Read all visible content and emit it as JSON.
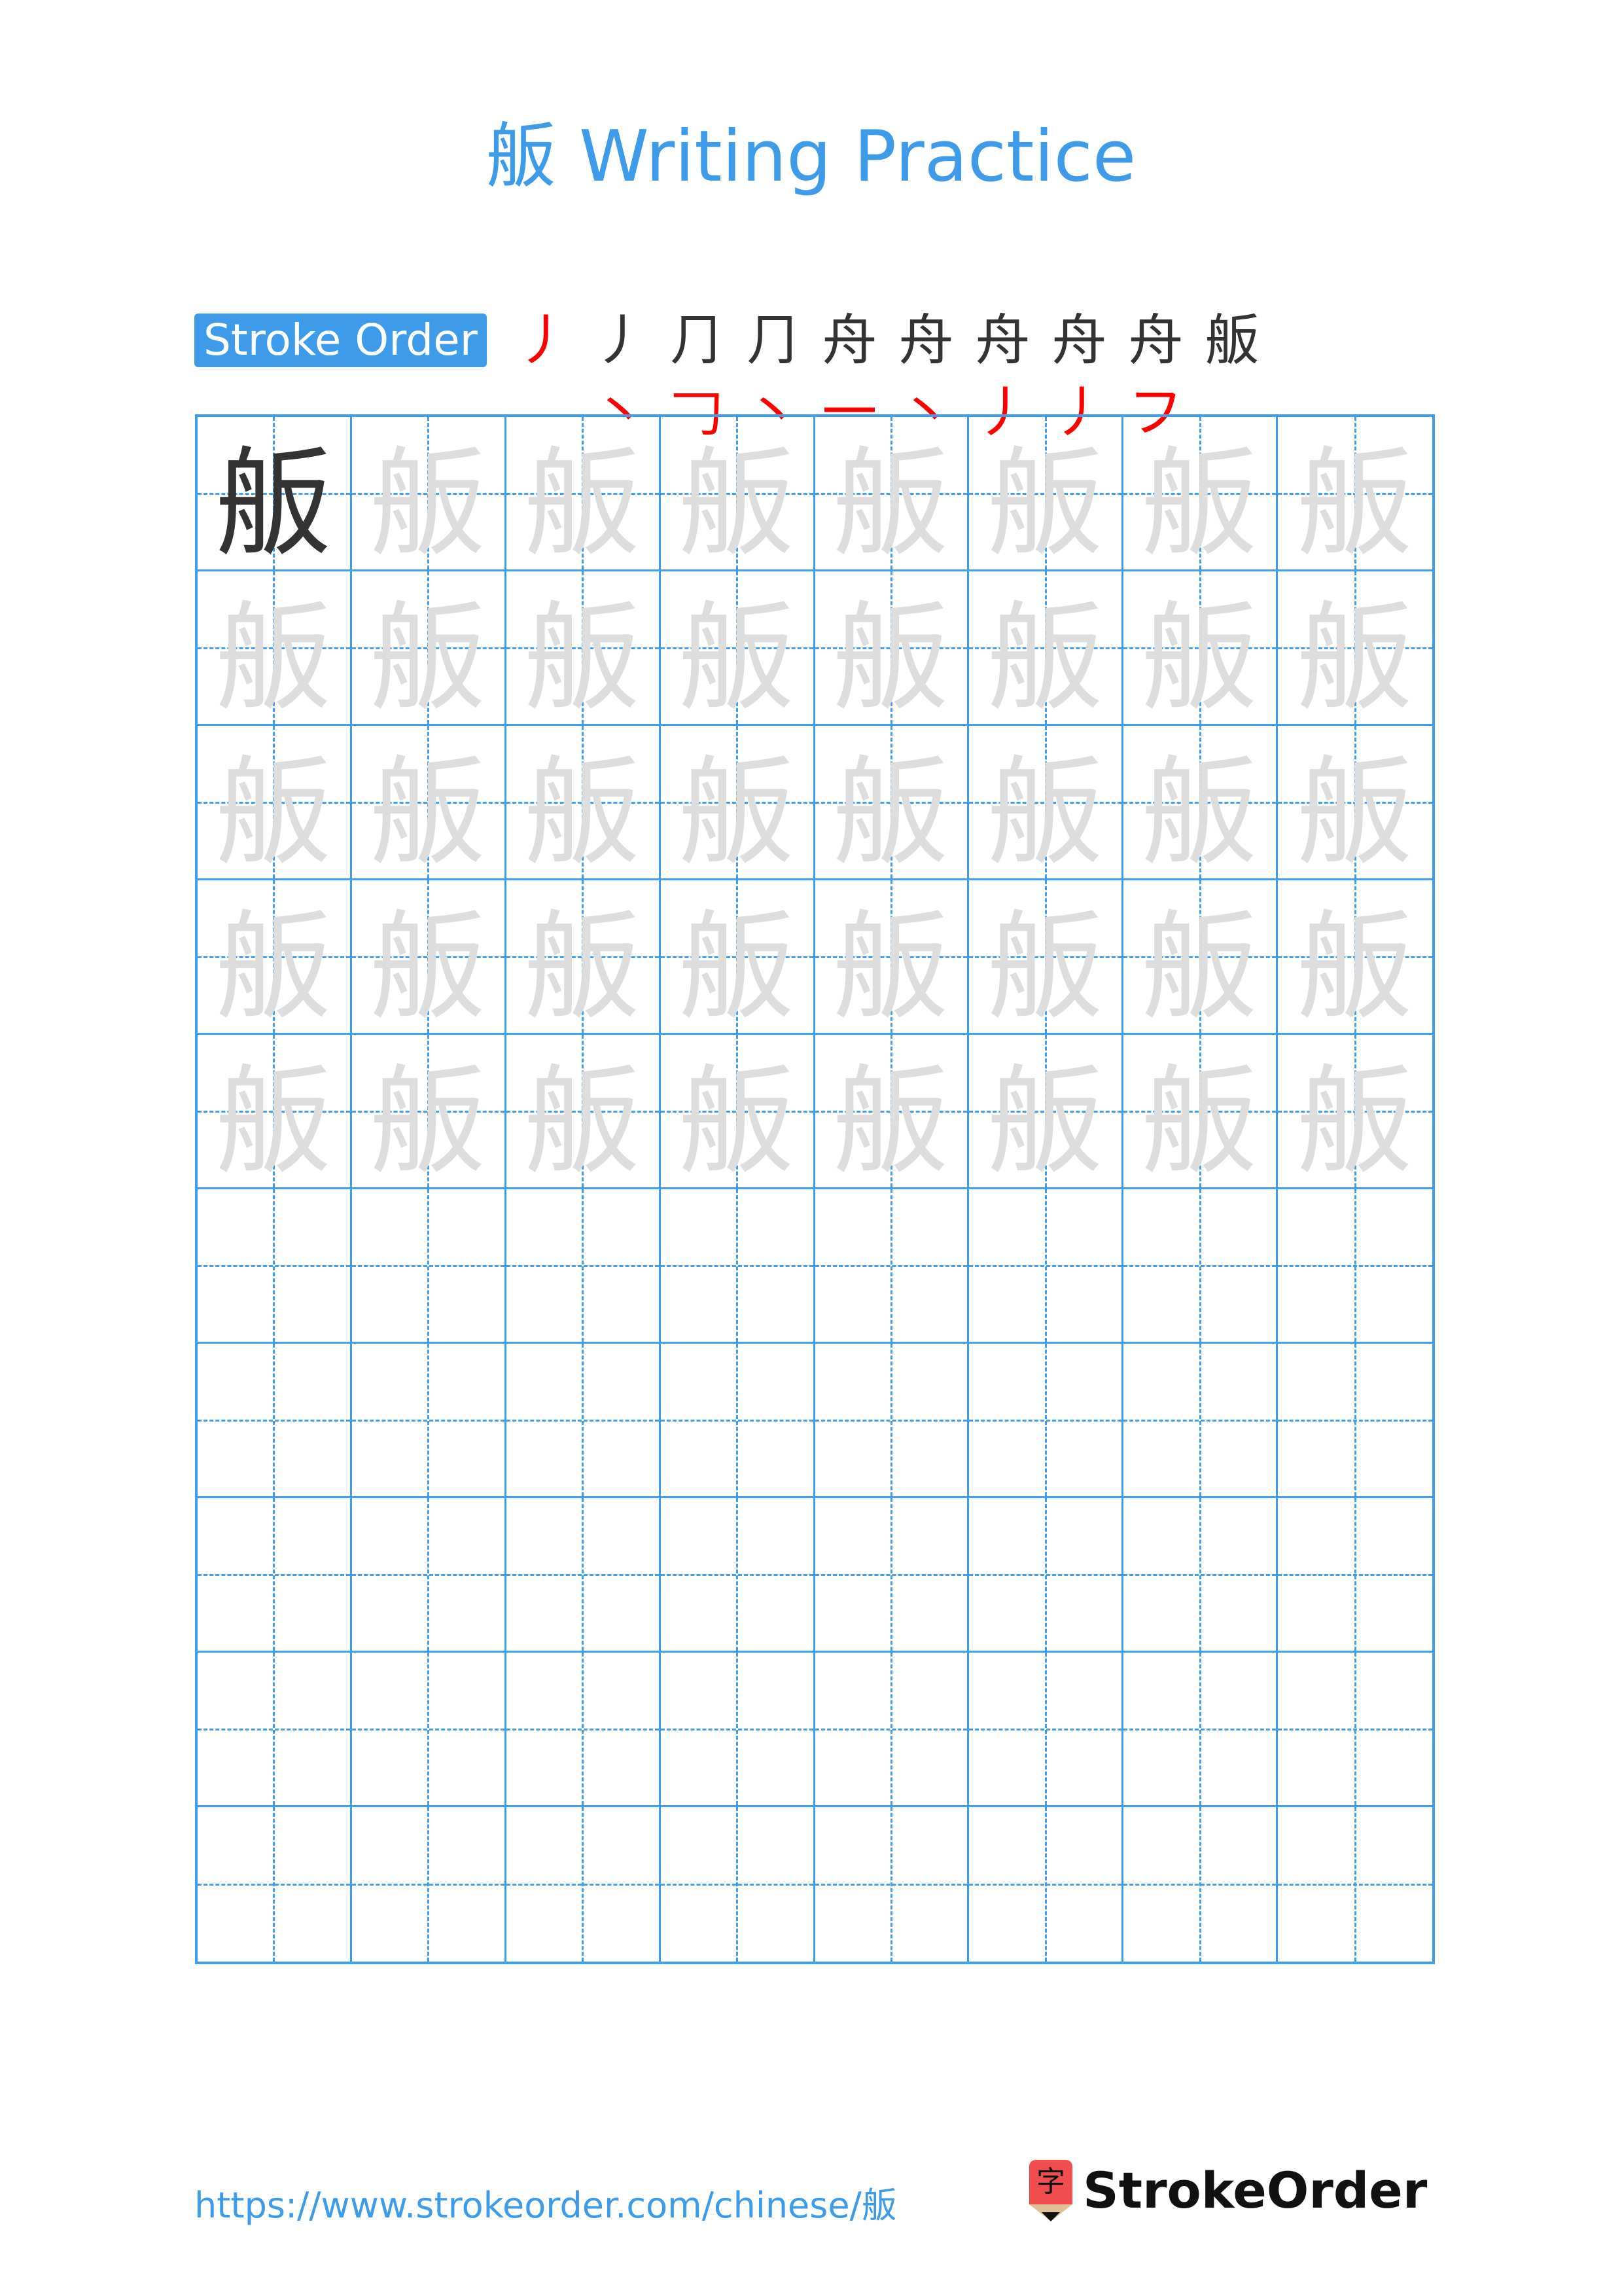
{
  "page": {
    "character": "舨",
    "title": "舨 Writing Practice"
  },
  "stroke_order": {
    "label": "Stroke Order",
    "steps": [
      {
        "done": "",
        "new": "丿"
      },
      {
        "done": "丿",
        "new": "丶"
      },
      {
        "done": "⺆",
        "new": "𠃌"
      },
      {
        "done": "⺆",
        "new": "丶"
      },
      {
        "done": "舟",
        "new": "一"
      },
      {
        "done": "舟",
        "new": "丶"
      },
      {
        "done": "舟",
        "new": "丿"
      },
      {
        "done": "舟",
        "new": "丿"
      },
      {
        "done": "舟",
        "new": "フ"
      },
      {
        "done": "舨",
        "new": ""
      }
    ],
    "colors": {
      "done": "#333333",
      "new": "#ff0000"
    }
  },
  "grid": {
    "rows": 10,
    "cols": 8,
    "filled_rows": 5,
    "model_cells": 1,
    "colors": {
      "line": "#409ef0",
      "model": "#333333",
      "trace": "#dddddd"
    }
  },
  "footer": {
    "url": "https://www.strokeorder.com/chinese/舨",
    "logo_glyph": "字",
    "logo_text": "StrokeOrder"
  }
}
